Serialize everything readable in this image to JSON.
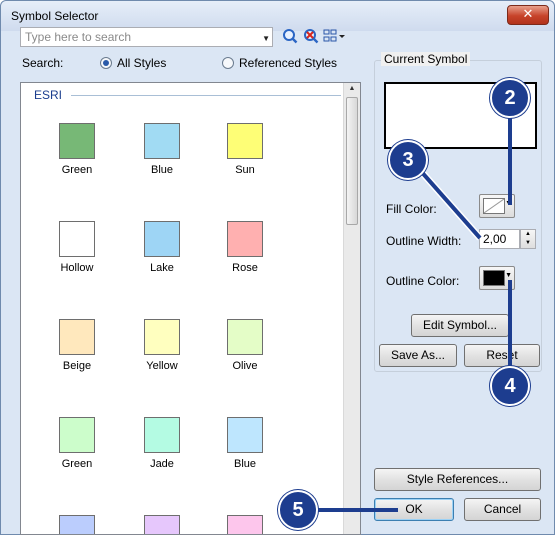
{
  "window": {
    "title": "Symbol Selector",
    "close_glyph": "✕"
  },
  "search": {
    "placeholder": "Type here to search",
    "label": "Search:",
    "scope_options": [
      {
        "label": "All Styles",
        "selected": true
      },
      {
        "label": "Referenced Styles",
        "selected": false
      }
    ],
    "icons": [
      "search-icon",
      "clear-search-icon",
      "view-options-icon"
    ]
  },
  "gallery": {
    "group_header": "ESRI",
    "symbols": [
      {
        "label": "Green",
        "color": "#77b876"
      },
      {
        "label": "Blue",
        "color": "#a1dbf3"
      },
      {
        "label": "Sun",
        "color": "#fefe76"
      },
      {
        "label": "Hollow",
        "color": "#ffffff"
      },
      {
        "label": "Lake",
        "color": "#9ed5f5"
      },
      {
        "label": "Rose",
        "color": "#ffb0b0"
      },
      {
        "label": "Beige",
        "color": "#ffe8bd"
      },
      {
        "label": "Yellow",
        "color": "#ffffbf"
      },
      {
        "label": "Olive",
        "color": "#e4fdc7"
      },
      {
        "label": "Green",
        "color": "#ccfdcb"
      },
      {
        "label": "Jade",
        "color": "#b4fbe3"
      },
      {
        "label": "Blue",
        "color": "#bee6fe"
      },
      {
        "label": "",
        "color": "#bbcdfd"
      },
      {
        "label": "",
        "color": "#e6c7fc"
      },
      {
        "label": "",
        "color": "#fdc6ec"
      }
    ]
  },
  "current_symbol": {
    "title": "Current Symbol",
    "fill_color_label": "Fill Color:",
    "outline_width_label": "Outline Width:",
    "outline_width_value": "2,00",
    "outline_color_label": "Outline Color:",
    "edit_symbol_label": "Edit Symbol...",
    "save_as_label": "Save As...",
    "reset_label": "Reset"
  },
  "footer": {
    "style_references_label": "Style References...",
    "ok_label": "OK",
    "cancel_label": "Cancel"
  },
  "callouts": [
    {
      "number": "2"
    },
    {
      "number": "3"
    },
    {
      "number": "4"
    },
    {
      "number": "5"
    }
  ],
  "colors": {
    "callout": "#1d3d8f",
    "outline_color": "#000000",
    "group_header": "#1a3d8e"
  }
}
